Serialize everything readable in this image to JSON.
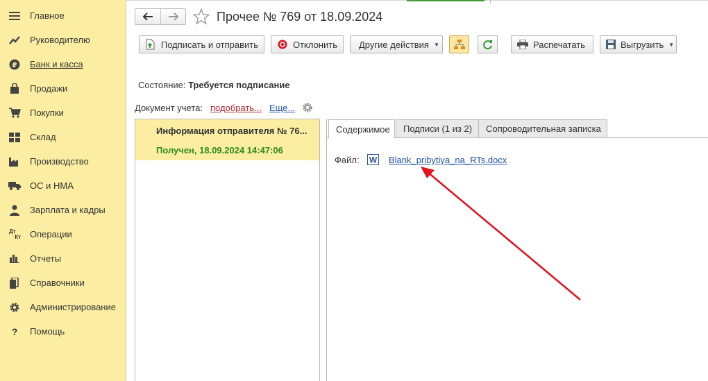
{
  "sidebar": {
    "items": [
      {
        "label": "Главное",
        "icon": "menu-icon"
      },
      {
        "label": "Руководителю",
        "icon": "trend-icon"
      },
      {
        "label": "Банк и касса",
        "icon": "ruble-icon"
      },
      {
        "label": "Продажи",
        "icon": "shopping-bag-icon"
      },
      {
        "label": "Покупки",
        "icon": "cart-icon"
      },
      {
        "label": "Склад",
        "icon": "warehouse-icon"
      },
      {
        "label": "Производство",
        "icon": "factory-icon"
      },
      {
        "label": "ОС и НМА",
        "icon": "truck-icon"
      },
      {
        "label": "Зарплата и кадры",
        "icon": "person-icon"
      },
      {
        "label": "Операции",
        "icon": "debit-credit-icon",
        "glyph_top": "Дт",
        "glyph_bottom": "Кт"
      },
      {
        "label": "Отчеты",
        "icon": "bar-chart-icon"
      },
      {
        "label": "Справочники",
        "icon": "books-icon"
      },
      {
        "label": "Администрирование",
        "icon": "gear-icon"
      },
      {
        "label": "Помощь",
        "icon": "question-icon",
        "glyph": "?"
      }
    ]
  },
  "header": {
    "title": "Прочее № 769 от 18.09.2024"
  },
  "toolbar": {
    "sign_send": "Подписать и отправить",
    "reject": "Отклонить",
    "other_actions": "Другие действия",
    "print": "Распечатать",
    "export": "Выгрузить"
  },
  "state": {
    "label": "Состояние:",
    "value": "Требуется подписание"
  },
  "account_doc": {
    "label": "Документ учета:",
    "pick_link": "подобрать...",
    "more_link": "Еще..."
  },
  "list": {
    "rows": [
      {
        "title": "Информация отправителя № 76...",
        "status": "Получен, 18.09.2024 14:47:06"
      }
    ]
  },
  "tabs": [
    {
      "label": "Содержимое"
    },
    {
      "label": "Подписи (1 из 2)"
    },
    {
      "label": "Сопроводительная записка"
    }
  ],
  "content": {
    "file_label": "Файл:",
    "file_name": "Blank_pribytiya_na_RTs.docx",
    "file_icon_glyph": "W"
  },
  "colors": {
    "sidebar_bg": "#fbeea2",
    "accent_red": "#e2141f",
    "status_green": "#2f8a1f",
    "link_blue": "#2352a4"
  }
}
